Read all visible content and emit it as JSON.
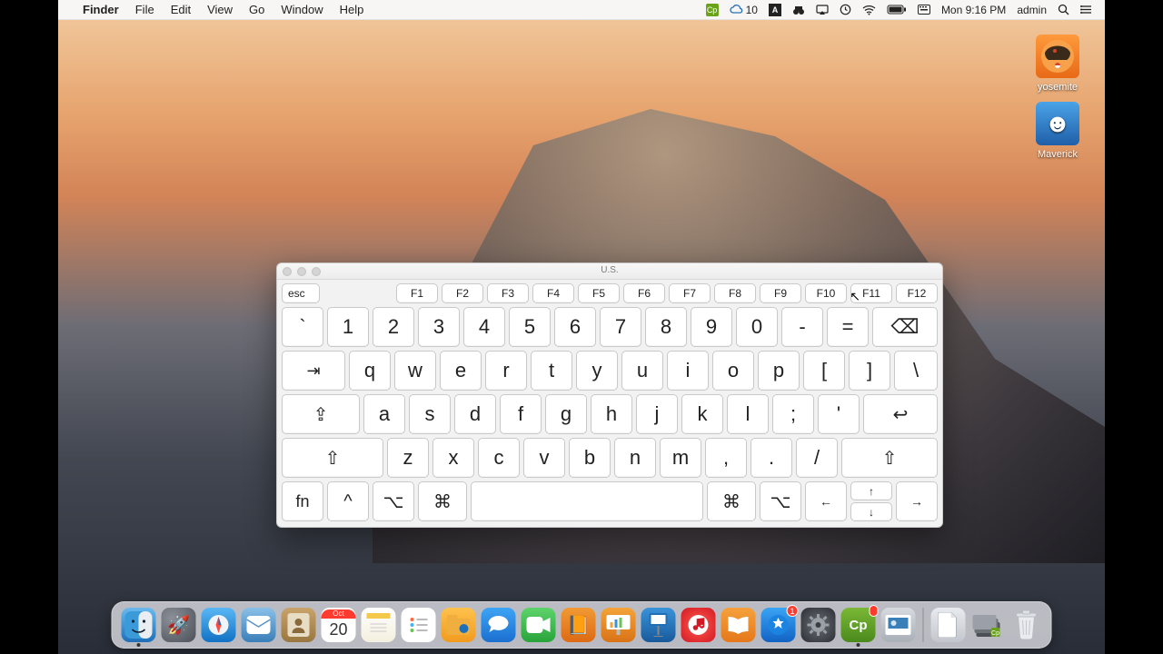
{
  "menubar": {
    "app": "Finder",
    "items": [
      "File",
      "Edit",
      "View",
      "Go",
      "Window",
      "Help"
    ],
    "status_number": "10",
    "clock": "Mon 9:16 PM",
    "user": "admin"
  },
  "desktop": {
    "icon1": {
      "label": "yosemite"
    },
    "icon2": {
      "label": "Maverick"
    }
  },
  "keyboard": {
    "title": "U.S.",
    "fn_row": [
      "esc",
      "F1",
      "F2",
      "F3",
      "F4",
      "F5",
      "F6",
      "F7",
      "F8",
      "F9",
      "F10",
      "F11",
      "F12"
    ],
    "row1": [
      "`",
      "1",
      "2",
      "3",
      "4",
      "5",
      "6",
      "7",
      "8",
      "9",
      "0",
      "-",
      "="
    ],
    "row2": [
      "q",
      "w",
      "e",
      "r",
      "t",
      "y",
      "u",
      "i",
      "o",
      "p",
      "[",
      "]",
      "\\"
    ],
    "row3": [
      "a",
      "s",
      "d",
      "f",
      "g",
      "h",
      "j",
      "k",
      "l",
      ";",
      "'"
    ],
    "row4": [
      "z",
      "x",
      "c",
      "v",
      "b",
      "n",
      "m",
      ",",
      ".",
      "/"
    ],
    "mods": {
      "tab": "⇥",
      "caps": "⇪",
      "shift": "⇧",
      "return": "↩",
      "backspace": "⌫",
      "fn": "fn",
      "ctrl": "^",
      "opt": "⌥",
      "cmd": "⌘",
      "up": "↑",
      "down": "↓",
      "left": "←",
      "right": "→"
    }
  },
  "dock": {
    "calendar": {
      "month": "Oct",
      "day": "20"
    },
    "appstore_badge": "1"
  }
}
